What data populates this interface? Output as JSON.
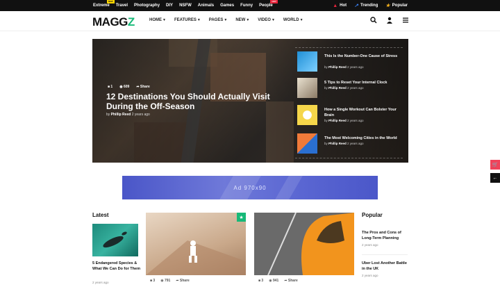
{
  "topbar": {
    "categories": [
      {
        "label": "Extreme",
        "badge": "NEW"
      },
      {
        "label": "Travel"
      },
      {
        "label": "Photography"
      },
      {
        "label": "DIY"
      },
      {
        "label": "NSFW"
      },
      {
        "label": "Animals"
      },
      {
        "label": "Games"
      },
      {
        "label": "Funny"
      },
      {
        "label": "People",
        "badge": "HOT"
      }
    ],
    "right": [
      {
        "label": "Hot",
        "icon": "flame-icon"
      },
      {
        "label": "Trending",
        "icon": "trending-icon"
      },
      {
        "label": "Popular",
        "icon": "star-icon"
      }
    ]
  },
  "header": {
    "logo_main": "MAGG",
    "logo_accent": "Z",
    "nav": [
      "HOME",
      "FEATURES",
      "PAGES",
      "NEW",
      "VIDEO",
      "WORLD"
    ],
    "icons": [
      "search-icon",
      "user-icon",
      "menu-icon"
    ]
  },
  "hero": {
    "comments": "1",
    "views": "609",
    "share": "Share",
    "title": "12 Destinations You Should Actually Visit During the Off-Season",
    "by_prefix": "by",
    "author": "Phillip Reed",
    "date": "2 years ago",
    "side": [
      {
        "title": "This Is the Number-One Cause of Stress",
        "author": "Phillip Reed",
        "date": "2 years ago",
        "color": "#1f8fd6"
      },
      {
        "title": "5 Tips to Reset Your Internal Clock",
        "author": "Phillip Reed",
        "date": "2 years ago",
        "color": "#c9b9a0"
      },
      {
        "title": "How a Single Workout Can Bolster Your Brain",
        "author": "Phillip Reed",
        "date": "2 years ago",
        "color": "#f5d64a"
      },
      {
        "title": "The Most Welcoming Cities in the World",
        "author": "Phillip Reed",
        "date": "2 years ago",
        "color": "#f07a3a"
      }
    ]
  },
  "ad": {
    "label": "Ad 970x90",
    "color": "#5a66d2"
  },
  "latest": {
    "heading": "Latest",
    "title": "5 Endangered Species & What We Can Do for Them",
    "date": "2 years ago"
  },
  "cards": [
    {
      "comments": "3",
      "views": "791",
      "share": "Share"
    },
    {
      "comments": "3",
      "views": "941",
      "share": "Share"
    }
  ],
  "popular": {
    "heading": "Popular",
    "items": [
      {
        "title": "The Pros and Cons of Long-Term Planning",
        "date": "2 years ago"
      },
      {
        "title": "Uber Lost Another Battle in the UK",
        "date": "2 years ago"
      }
    ]
  },
  "colors": {
    "accent": "#17b978",
    "hot": "#e8243b",
    "badge_new": "#ffd800",
    "cart": "#f0435a"
  }
}
